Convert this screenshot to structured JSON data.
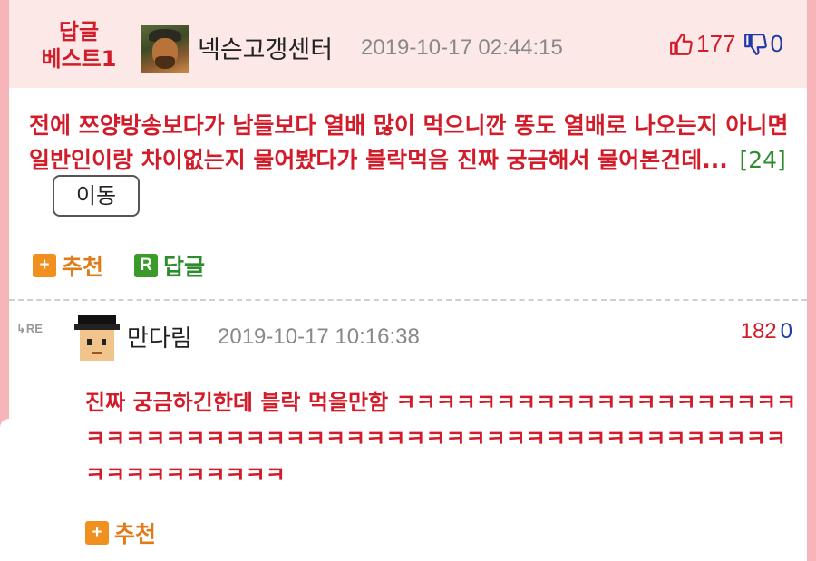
{
  "best_comment": {
    "badge_line1": "답글",
    "badge_line2": "베스트1",
    "nickname": "넥슨고갱센터",
    "datetime": "2019-10-17 02:44:15",
    "upvotes": "177",
    "downvotes": "0",
    "content": "전에 쯔양방송보다가 남들보다 열배 많이 먹으니깐 똥도 열배로 나오는지 아니면 일반인이랑 차이없는지 물어봤다가 블락먹음 진짜 궁금해서 물어본건데...",
    "reply_count": "[24]",
    "move_button": "이동",
    "recommend_label": "추천",
    "reply_label": "답글",
    "recommend_icon": "+",
    "reply_icon": "R"
  },
  "reply": {
    "re_marker": "↳RE",
    "nickname": "만다림",
    "datetime": "2019-10-17 10:16:38",
    "upvotes": "182",
    "downvotes": "0",
    "content": "진짜 궁금하긴한데 블락 먹을만함 ㅋㅋㅋㅋㅋㅋㅋㅋㅋㅋㅋㅋㅋㅋㅋㅋㅋㅋㅋㅋㅋㅋㅋㅋㅋㅋㅋㅋㅋㅋㅋㅋㅋㅋㅋㅋㅋㅋㅋㅋㅋㅋㅋㅋㅋㅋㅋㅋㅋㅋㅋㅋㅋㅋㅋㅋㅋㅋㅋㅋㅋㅋㅋㅋㅋ",
    "recommend_label": "추천",
    "recommend_icon": "+"
  },
  "colors": {
    "background": "#f7b4b9",
    "header_bg": "#fde8e8",
    "accent_red": "#d31c2a",
    "down_blue": "#1f3aa8",
    "reply_green": "#2e8b2e",
    "recommend_orange": "#f0901e"
  },
  "icons": {
    "thumbs_up": "thumbs-up-icon",
    "thumbs_down": "thumbs-down-icon"
  }
}
